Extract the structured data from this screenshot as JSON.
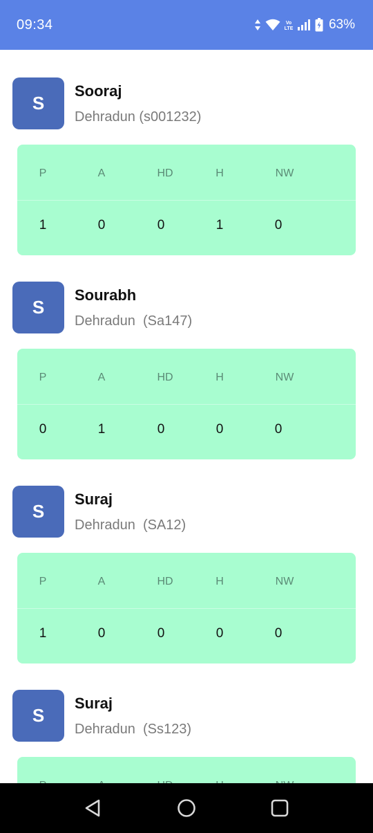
{
  "status_bar": {
    "time": "09:34",
    "battery": "63%",
    "volte": "Vo\nLTE",
    "icons": [
      "data-arrows-icon",
      "wifi-icon",
      "volte-icon",
      "signal-icon",
      "battery-icon"
    ]
  },
  "columns": [
    "P",
    "A",
    "HD",
    "H",
    "NW"
  ],
  "employees": [
    {
      "initial": "S",
      "name": "Sooraj",
      "location": "Dehradun (s001232)",
      "values": [
        "1",
        "0",
        "0",
        "1",
        "0"
      ]
    },
    {
      "initial": "S",
      "name": "Sourabh",
      "location": "Dehradun  (Sa147)",
      "values": [
        "0",
        "1",
        "0",
        "0",
        "0"
      ]
    },
    {
      "initial": "S",
      "name": "Suraj",
      "location": "Dehradun  (SA12)",
      "values": [
        "1",
        "0",
        "0",
        "0",
        "0"
      ]
    },
    {
      "initial": "S",
      "name": "Suraj",
      "location": "Dehradun  (Ss123)",
      "values": [
        "",
        "",
        "",
        "",
        ""
      ]
    }
  ],
  "nav_bar": {
    "icons": [
      "back-icon",
      "home-icon",
      "recents-icon"
    ]
  },
  "colors": {
    "header": "#5a82e6",
    "avatar": "#4a6bb9",
    "stats_bg": "#a8fdd0"
  }
}
